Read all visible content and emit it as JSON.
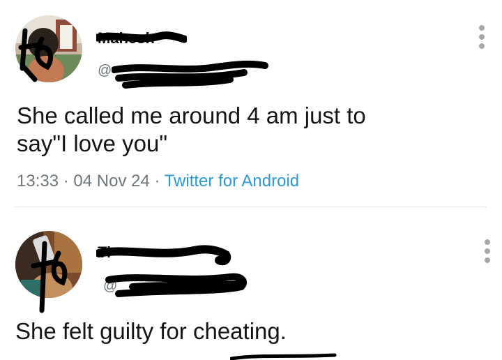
{
  "tweets": [
    {
      "name": "Mahesh",
      "handle": "@",
      "text": "She called me around 4 am just to say\"I love you\"",
      "time": "13:33",
      "date": "04 Nov 24",
      "source": "Twitter for Android",
      "separator": "·"
    },
    {
      "name": "Ti",
      "handle": "@",
      "text": "She felt guilty for cheating."
    }
  ],
  "icons": [
    "more-vertical-icon"
  ],
  "colors": {
    "source_link": "#2c98d4",
    "meta_text": "#6e767d",
    "redaction": "#000000"
  }
}
